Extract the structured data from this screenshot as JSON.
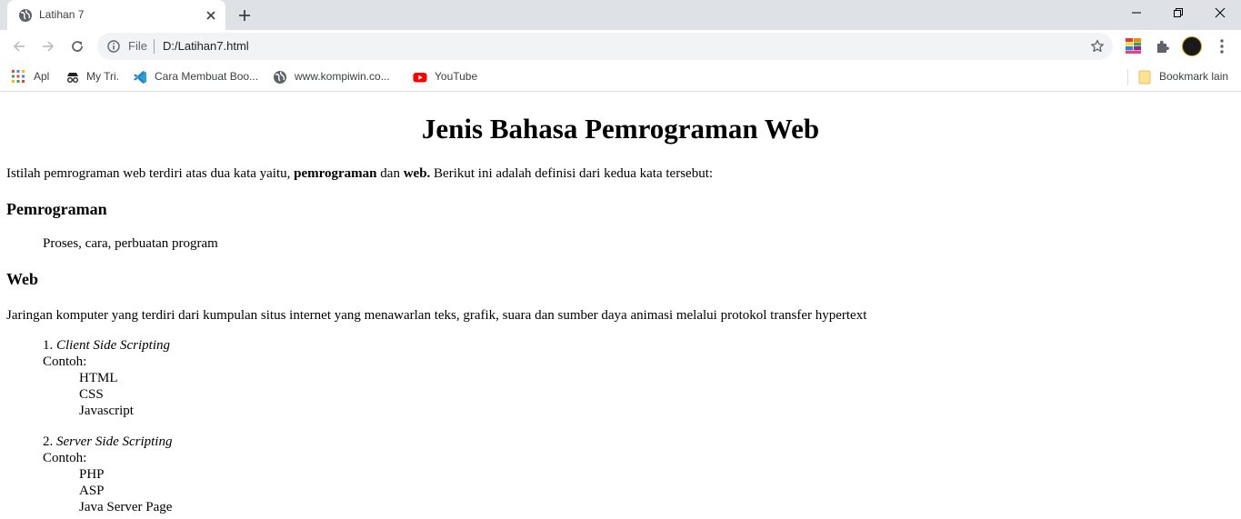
{
  "browser": {
    "tab": {
      "title": "Latihan 7"
    },
    "omnibox": {
      "scheme_label": "File",
      "url": "D:/Latihan7.html"
    },
    "bookmarks": [
      {
        "label": "Apl"
      },
      {
        "label": "My Tri."
      },
      {
        "label": "Cara Membuat Boo..."
      },
      {
        "label": "www.kompiwin.co..."
      },
      {
        "label": "YouTube"
      }
    ],
    "other_bookmarks": "Bookmark lain"
  },
  "page": {
    "title": "Jenis Bahasa Pemrograman Web",
    "intro": {
      "part1": "Istilah pemrograman web terdiri atas dua kata yaitu, ",
      "bold1": "pemrograman",
      "part2": " dan ",
      "bold2": "web.",
      "part3": " Berikut ini adalah definisi dari kedua kata tersebut:"
    },
    "terms": [
      {
        "term": "Pemrograman",
        "definition": "Proses, cara, perbuatan program"
      },
      {
        "term": "Web",
        "definition": "Jaringan komputer yang terdiri dari kumpulan situs internet yang menawarlan teks, grafik, suara dan sumber daya animasi melalui protokol transfer hypertext"
      }
    ],
    "scripting": [
      {
        "number": "1. ",
        "name": "Client Side Scripting",
        "example_label": "Contoh:",
        "examples": [
          "HTML",
          "CSS",
          "Javascript"
        ]
      },
      {
        "number": "2. ",
        "name": "Server Side Scripting",
        "example_label": "Contoh:",
        "examples": [
          "PHP",
          "ASP",
          "Java Server Page"
        ]
      }
    ]
  }
}
